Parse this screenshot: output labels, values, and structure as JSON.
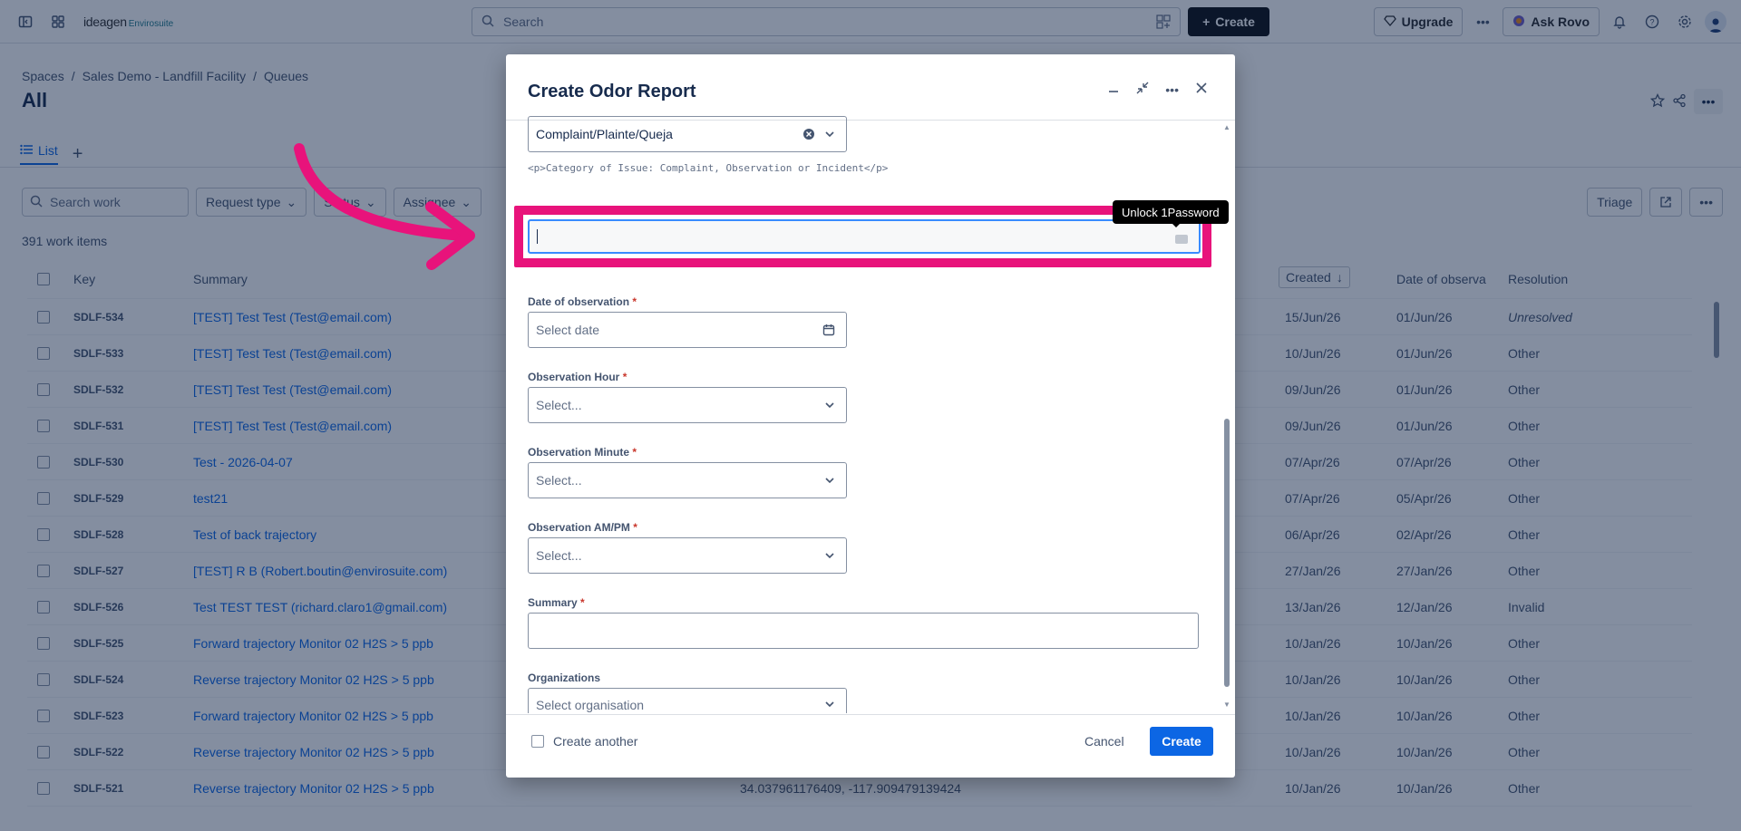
{
  "topnav": {
    "logo_main": "ideagen",
    "logo_sub": "Envirosuite",
    "search_placeholder": "Search",
    "create_label": "Create",
    "upgrade_label": "Upgrade",
    "ask_rovo_label": "Ask Rovo"
  },
  "breadcrumb": [
    "Spaces",
    "Sales Demo - Landfill Facility",
    "Queues"
  ],
  "page": {
    "title": "All",
    "tab_list": "List"
  },
  "filters": {
    "search_placeholder": "Search work",
    "request_type": "Request type",
    "status": "Status",
    "assignee": "Assignee",
    "triage": "Triage"
  },
  "work_count": "391 work items",
  "table": {
    "headers": {
      "key": "Key",
      "summary": "Summary",
      "created": "Created",
      "date_obs": "Date of observa",
      "resolution": "Resolution"
    },
    "rows": [
      {
        "key": "SDLF-534",
        "summary": "[TEST] Test Test (Test@email.com)",
        "created": "15/Jun/26",
        "date_obs": "01/Jun/26",
        "resolution": "Unresolved"
      },
      {
        "key": "SDLF-533",
        "summary": "[TEST] Test Test (Test@email.com)",
        "created": "10/Jun/26",
        "date_obs": "01/Jun/26",
        "resolution": "Other"
      },
      {
        "key": "SDLF-532",
        "summary": "[TEST] Test Test (Test@email.com)",
        "created": "09/Jun/26",
        "date_obs": "01/Jun/26",
        "resolution": "Other"
      },
      {
        "key": "SDLF-531",
        "summary": "[TEST] Test Test (Test@email.com)",
        "created": "09/Jun/26",
        "date_obs": "01/Jun/26",
        "resolution": "Other"
      },
      {
        "key": "SDLF-530",
        "summary": "Test - 2026-04-07",
        "created": "07/Apr/26",
        "date_obs": "07/Apr/26",
        "resolution": "Other"
      },
      {
        "key": "SDLF-529",
        "summary": "test21",
        "created": "07/Apr/26",
        "date_obs": "05/Apr/26",
        "resolution": "Other"
      },
      {
        "key": "SDLF-528",
        "summary": "Test of back trajectory",
        "created": "06/Apr/26",
        "date_obs": "02/Apr/26",
        "resolution": "Other"
      },
      {
        "key": "SDLF-527",
        "summary": "[TEST] R B (Robert.boutin@envirosuite.com)",
        "created": "27/Jan/26",
        "date_obs": "27/Jan/26",
        "resolution": "Other"
      },
      {
        "key": "SDLF-526",
        "summary": "Test TEST TEST (richard.claro1@gmail.com)",
        "created": "13/Jan/26",
        "date_obs": "12/Jan/26",
        "resolution": "Invalid"
      },
      {
        "key": "SDLF-525",
        "summary": "Forward trajectory Monitor 02 H2S > 5 ppb",
        "created": "10/Jan/26",
        "date_obs": "10/Jan/26",
        "resolution": "Other"
      },
      {
        "key": "SDLF-524",
        "summary": "Reverse trajectory Monitor 02 H2S > 5 ppb",
        "created": "10/Jan/26",
        "date_obs": "10/Jan/26",
        "resolution": "Other"
      },
      {
        "key": "SDLF-523",
        "summary": "Forward trajectory Monitor 02 H2S > 5 ppb",
        "created": "10/Jan/26",
        "date_obs": "10/Jan/26",
        "resolution": "Other"
      },
      {
        "key": "SDLF-522",
        "summary": "Reverse trajectory Monitor 02 H2S > 5 ppb",
        "created": "10/Jan/26",
        "date_obs": "10/Jan/26",
        "resolution": "Other"
      },
      {
        "key": "SDLF-521",
        "summary": "Reverse trajectory Monitor 02 H2S > 5 ppb",
        "created": "10/Jan/26",
        "date_obs": "10/Jan/26",
        "resolution": "Other",
        "coords": "34.037961176409, -117.909479139424"
      }
    ]
  },
  "modal": {
    "title": "Create Odor Report",
    "category_value": "Complaint/Plainte/Queja",
    "category_helper": "<p>Category of Issue: Complaint, Observation or Incident</p>",
    "date_label": "Date of observation",
    "date_placeholder": "Select date",
    "hour_label": "Observation Hour",
    "minute_label": "Observation Minute",
    "ampm_label": "Observation AM/PM",
    "select_placeholder": "Select...",
    "summary_label": "Summary",
    "org_label": "Organizations",
    "org_placeholder": "Select organisation",
    "create_another": "Create another",
    "cancel": "Cancel",
    "create": "Create",
    "required_mark": "*"
  },
  "tooltip": "Unlock 1Password",
  "colors": {
    "highlight": "#e8137b",
    "primary": "#0c66e4",
    "overlay": "rgba(9,30,66,0.5)"
  }
}
